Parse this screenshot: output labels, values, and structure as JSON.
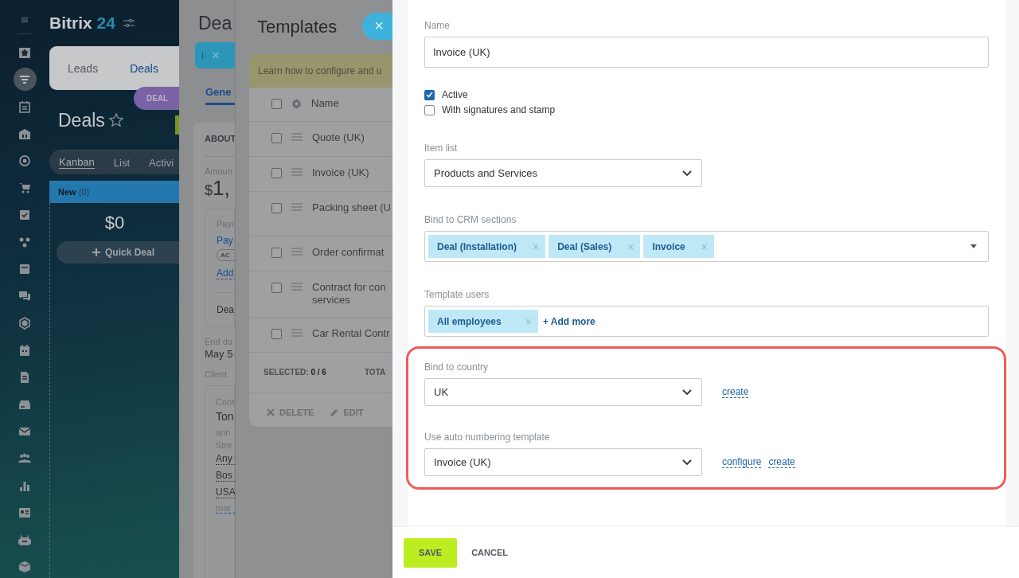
{
  "sidebar": {
    "items": [
      {
        "selected": false
      },
      {
        "selected": true
      },
      {
        "selected": false
      },
      {
        "selected": false
      },
      {
        "selected": false
      },
      {
        "selected": false
      },
      {
        "selected": false
      },
      {
        "selected": false
      },
      {
        "selected": false
      },
      {
        "selected": false
      },
      {
        "selected": false
      },
      {
        "selected": false
      },
      {
        "selected": false
      },
      {
        "selected": false
      },
      {
        "selected": false
      },
      {
        "selected": false
      },
      {
        "selected": false
      },
      {
        "selected": false
      },
      {
        "selected": false
      },
      {
        "selected": false
      }
    ]
  },
  "crm": {
    "logo_word": "Bitrix",
    "logo_number": "24",
    "tabs": [
      {
        "label": "Leads",
        "selected": false
      },
      {
        "label": "Deals",
        "selected": true
      }
    ],
    "badge": "DEAL",
    "title": "Deals",
    "views": [
      {
        "label": "Kanban",
        "selected": true
      },
      {
        "label": "List",
        "selected": false
      },
      {
        "label": "Activi",
        "selected": false
      }
    ],
    "column": {
      "title": "New",
      "count": "(0)",
      "sum": "$0",
      "quick_deal": "Quick Deal"
    }
  },
  "deal_panel": {
    "title": "Dea",
    "tag": "I",
    "tag_remove": "×",
    "tab": "Gene",
    "section": "ABOUT",
    "amount_label": "Amoun",
    "currency": "$",
    "amount": "1,",
    "payment_label": "Payı",
    "payment_link": "Pay",
    "status": "AC",
    "add_link": "Add",
    "deal_text": "Dea",
    "end_label": "End da",
    "end_value": "May 5",
    "client_label": "Client",
    "contact_label": "Cont",
    "contact_name": "Ton",
    "contact_lines": [
      "ann",
      "Stre"
    ],
    "address_lines": [
      "Any",
      "Bos",
      "USA"
    ],
    "more": "mor"
  },
  "templates": {
    "title": "Templates",
    "close": "×",
    "hint": "Learn how to configure and u",
    "header": "Name",
    "header_checked": false,
    "rows": [
      {
        "lines": [
          "Quote (UK)"
        ],
        "checked": false
      },
      {
        "lines": [
          "Invoice (UK)"
        ],
        "checked": false
      },
      {
        "lines": [
          "Packing sheet (U"
        ],
        "checked": false
      },
      {
        "lines": [
          "Order confirmat"
        ],
        "checked": false
      },
      {
        "lines": [
          "Contract for con",
          "services"
        ],
        "checked": false
      },
      {
        "lines": [
          "Car Rental Contr"
        ],
        "checked": false
      }
    ],
    "selected": "SELECTED: **0 / 6**",
    "total": "TOTA",
    "actions": [
      {
        "label": "DELETE",
        "kind": "delete"
      },
      {
        "label": "EDIT",
        "kind": "edit"
      }
    ]
  },
  "form": {
    "name_label": "Name",
    "name_value": "Invoice (UK)",
    "options": [
      {
        "label": "Active",
        "checked": true
      },
      {
        "label": "With signatures and stamp",
        "checked": false
      }
    ],
    "item_list_label": "Item list",
    "item_list_value": "Products and Services",
    "crm_label": "Bind to CRM sections",
    "crm_tags": [
      {
        "label": "Deal (Installation)",
        "remove": "×"
      },
      {
        "label": "Deal (Sales)",
        "remove": "×"
      },
      {
        "label": "Invoice",
        "remove": "×"
      }
    ],
    "users_label": "Template users",
    "users_tags": [
      {
        "label": "All employees",
        "remove": "×"
      }
    ],
    "add_more": "+ Add more",
    "highlighted": true,
    "country_label": "Bind to country",
    "country_value": "UK",
    "country_links": [
      "create"
    ],
    "numbering_label": "Use auto numbering template",
    "numbering_value": "Invoice (UK)",
    "numbering_links": [
      "configure",
      "create"
    ]
  },
  "footer": {
    "save": "SAVE",
    "cancel": "CANCEL"
  }
}
